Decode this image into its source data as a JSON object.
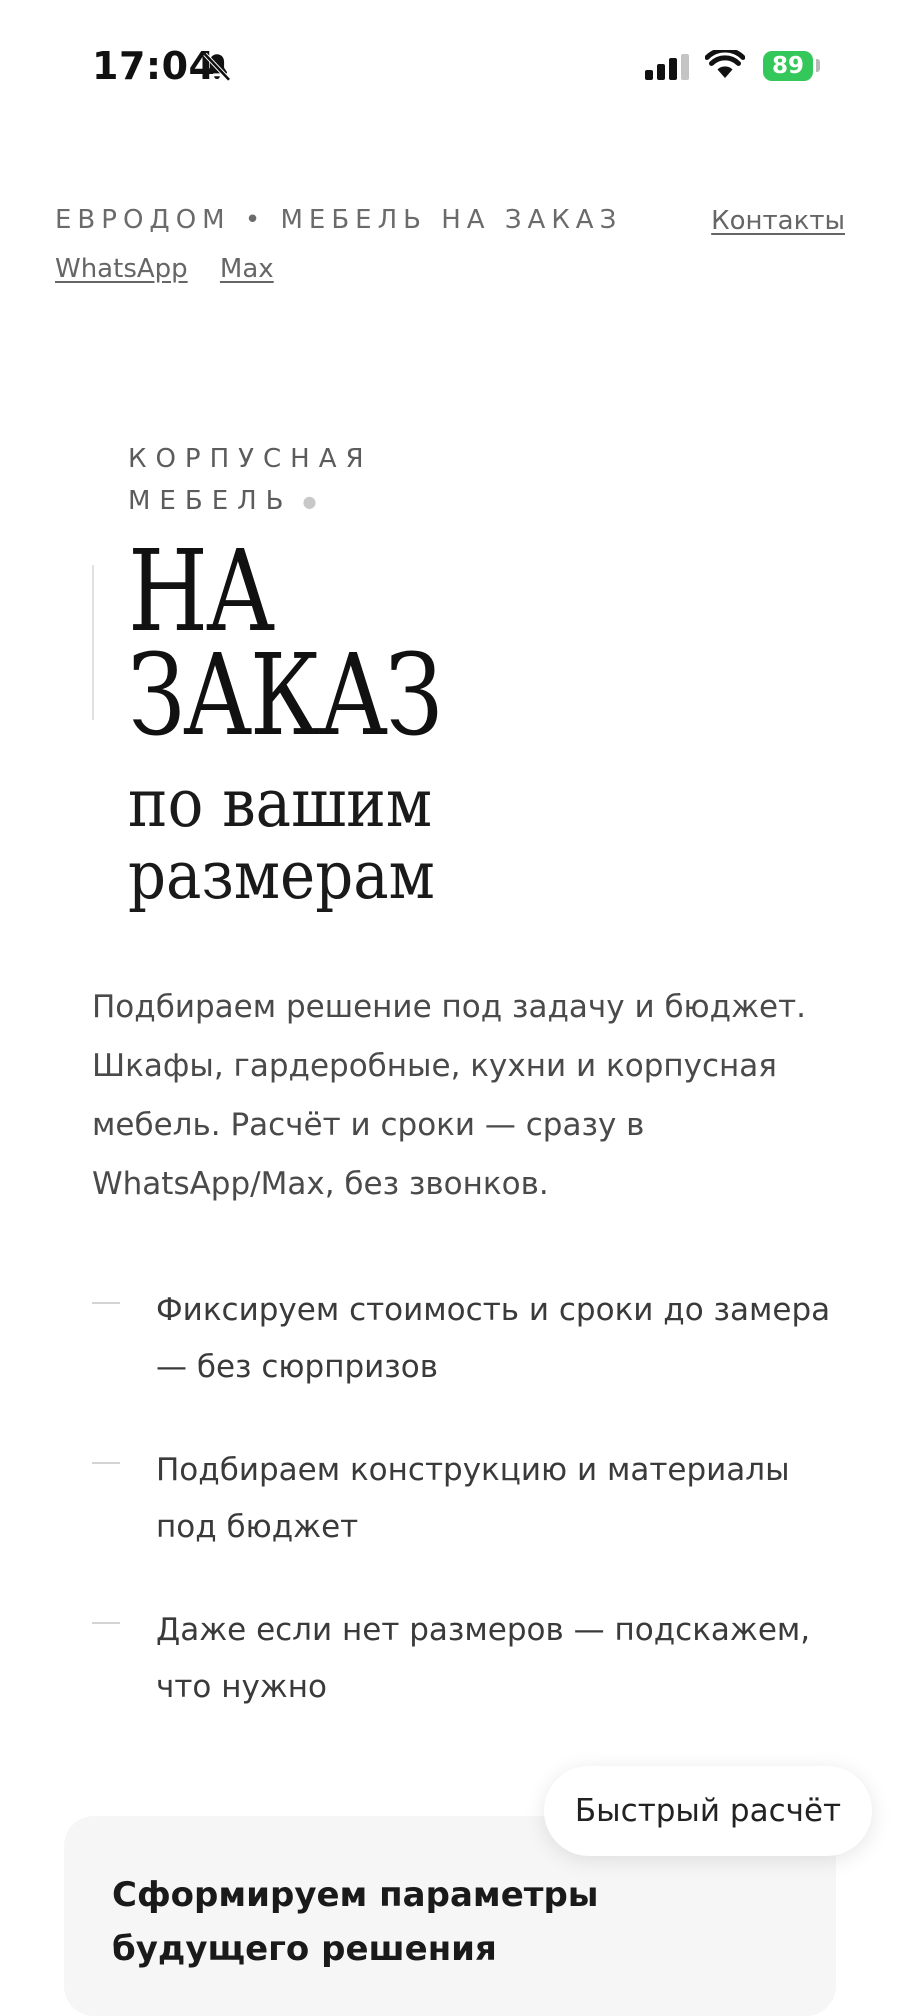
{
  "status_bar": {
    "time": "17:04",
    "battery": "89",
    "icons": [
      "bell-slash-icon",
      "cellular-signal-icon",
      "wifi-icon",
      "battery-icon"
    ]
  },
  "header": {
    "brand": "ЕВРОДОМ • МЕБЕЛЬ НА ЗАКАЗ",
    "contacts": "Контакты",
    "links": [
      "WhatsApp",
      "Max"
    ]
  },
  "hero": {
    "eyebrow_line1": "КОРПУСНАЯ",
    "eyebrow_line2": "МЕБЕЛЬ",
    "title_line1": "НА",
    "title_line2": "ЗАКАЗ",
    "subtitle_line1": "по вашим",
    "subtitle_line2": "размерам"
  },
  "intro": "Подбираем решение под задачу и бюджет. Шкафы, гардеробные, кухни и корпусная мебель. Расчёт и сроки — сразу в WhatsApp/Max, без звонков.",
  "features": [
    "Фиксируем стоимость и сроки до замера — без сюрпризов",
    "Подбираем конструкцию и материалы под бюджет",
    "Даже если нет размеров — подскажем, что нужно"
  ],
  "floating_button": "Быстрый расчёт",
  "card": {
    "title": "Сформируем параметры будущего решения"
  },
  "colors": {
    "battery": "#34c759",
    "text": "#1c1c1c",
    "muted": "#6b6b6b"
  }
}
